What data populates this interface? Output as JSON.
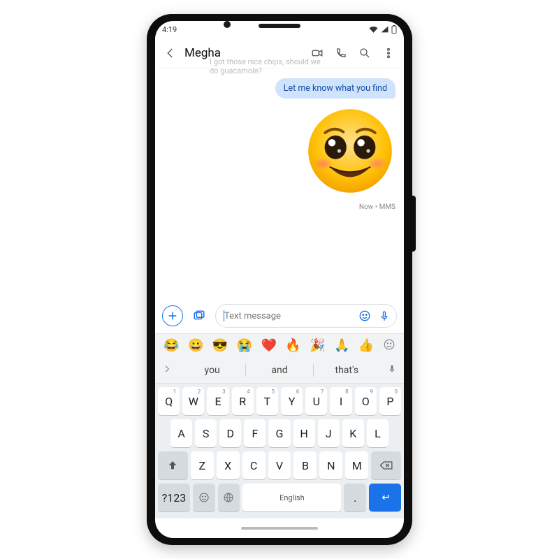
{
  "statusbar": {
    "time": "4:19"
  },
  "header": {
    "contact_name": "Megha",
    "prev_msg_1": "I got those nice chips, should we",
    "prev_msg_2": "do guacamole?"
  },
  "conversation": {
    "sent_bubble": "Let me know what you find",
    "meta": "Now • MMS"
  },
  "compose": {
    "placeholder": "Text message"
  },
  "emoji_row": [
    "😂",
    "😀",
    "😎",
    "😭",
    "❤️",
    "🔥",
    "🎉",
    "🙏",
    "👍"
  ],
  "suggestions": {
    "w1": "you",
    "w2": "and",
    "w3": "that's"
  },
  "keyboard": {
    "row1": [
      {
        "c": "Q",
        "n": "1"
      },
      {
        "c": "W",
        "n": "2"
      },
      {
        "c": "E",
        "n": "3"
      },
      {
        "c": "R",
        "n": "4"
      },
      {
        "c": "T",
        "n": "5"
      },
      {
        "c": "Y",
        "n": "6"
      },
      {
        "c": "U",
        "n": "7"
      },
      {
        "c": "I",
        "n": "8"
      },
      {
        "c": "O",
        "n": "9"
      },
      {
        "c": "P",
        "n": "0"
      }
    ],
    "row2": [
      "A",
      "S",
      "D",
      "F",
      "G",
      "H",
      "J",
      "K",
      "L"
    ],
    "row3": [
      "Z",
      "X",
      "C",
      "V",
      "B",
      "N",
      "M"
    ],
    "sym": "?123",
    "space": "English"
  }
}
